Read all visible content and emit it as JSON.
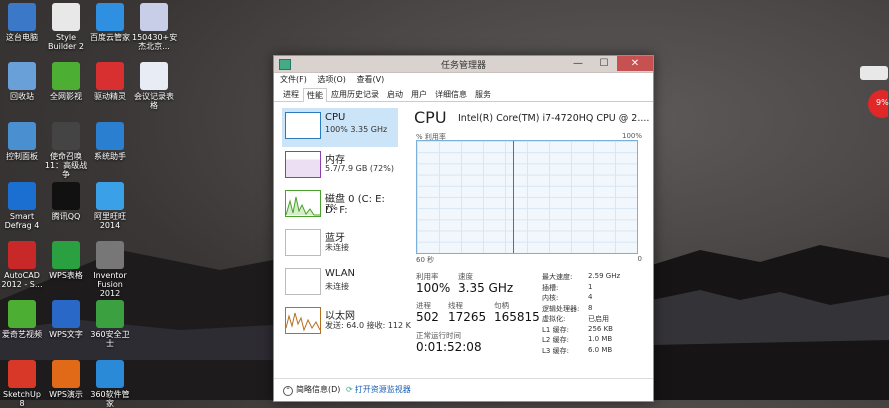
{
  "desktop": {
    "icons": [
      {
        "label": "这台电脑",
        "icon": "computer-icon",
        "color": "#3c78c8"
      },
      {
        "label": "Style Builder 2",
        "icon": "style-builder-icon",
        "color": "#e8e8e8"
      },
      {
        "label": "百度云管家",
        "icon": "baidu-cloud-icon",
        "color": "#2f8fe0"
      },
      {
        "label": "150430+安杰北京...",
        "icon": "file-icon",
        "color": "#c8cde8"
      },
      {
        "label": "回收站",
        "icon": "recycle-bin-icon",
        "color": "#6aa0d8"
      },
      {
        "label": "全网影视",
        "icon": "iqiyi-icon",
        "color": "#4cae32"
      },
      {
        "label": "驱动精灵",
        "icon": "driver-genius-icon",
        "color": "#d83030"
      },
      {
        "label": "会议记录表格",
        "icon": "doc-icon",
        "color": "#e8ecf4"
      },
      {
        "label": "控制面板",
        "icon": "control-panel-icon",
        "color": "#4a90d0"
      },
      {
        "label": "使命召唤11：高级战争",
        "icon": "game-icon",
        "color": "#444"
      },
      {
        "label": "系统助手",
        "icon": "system-assistant-icon",
        "color": "#2a7fd0"
      },
      {
        "label": "Smart Defrag 4",
        "icon": "defrag-icon",
        "color": "#1a6fd0"
      },
      {
        "label": "腾讯QQ",
        "icon": "qq-icon",
        "color": "#111"
      },
      {
        "label": "阿里旺旺 2014",
        "icon": "aliwangwang-icon",
        "color": "#3aa0e8"
      },
      {
        "label": "AutoCAD 2012 - S...",
        "icon": "autocad-icon",
        "color": "#c82828"
      },
      {
        "label": "WPS表格",
        "icon": "wps-sheet-icon",
        "color": "#2aa040"
      },
      {
        "label": "Inventor Fusion 2012",
        "icon": "inventor-icon",
        "color": "#777"
      },
      {
        "label": "爱奇艺视频",
        "icon": "iqiyi-video-icon",
        "color": "#4cae32"
      },
      {
        "label": "WPS文字",
        "icon": "wps-writer-icon",
        "color": "#2a68c8"
      },
      {
        "label": "360安全卫士",
        "icon": "360-security-icon",
        "color": "#3aa040"
      },
      {
        "label": "SketchUp 8",
        "icon": "sketchup-icon",
        "color": "#d83828"
      },
      {
        "label": "WPS演示",
        "icon": "wps-present-icon",
        "color": "#e06a18"
      },
      {
        "label": "360软件管家",
        "icon": "360-software-icon",
        "color": "#2a8ad8"
      }
    ]
  },
  "window": {
    "title": "任务管理器",
    "controls": {
      "minimize": "—",
      "maximize": "☐",
      "close": "✕"
    },
    "menu": [
      "文件(F)",
      "选项(O)",
      "查看(V)"
    ],
    "tabs": [
      "进程",
      "性能",
      "应用历史记录",
      "启动",
      "用户",
      "详细信息",
      "服务"
    ],
    "active_tab": "性能"
  },
  "sidebar": {
    "items": [
      {
        "name": "CPU",
        "sub": "100% 3.35 GHz",
        "color": "#2b7bbd"
      },
      {
        "name": "内存",
        "sub": "5.7/7.9 GB (72%)",
        "color": "#8b3fb0"
      },
      {
        "name": "磁盘 0 (C: E: D: F:",
        "sub": "7%",
        "color": "#4aa02c"
      },
      {
        "name": "蓝牙",
        "sub": "未连接",
        "color": "#999"
      },
      {
        "name": "WLAN",
        "sub": "未连接",
        "color": "#999"
      },
      {
        "name": "以太网",
        "sub": "发送: 64.0 接收: 112 K",
        "color": "#b56f1e"
      }
    ]
  },
  "main": {
    "title": "CPU",
    "model": "Intel(R) Core(TM) i7-4720HQ CPU @ 2....",
    "graph_label": "% 利用率",
    "graph_max": "100%",
    "graph_time": "60 秒",
    "graph_min": "0",
    "stats": {
      "util_label": "利用率",
      "util": "100%",
      "speed_label": "速度",
      "speed": "3.35 GHz",
      "proc_label": "进程",
      "proc": "502",
      "thread_label": "线程",
      "thread": "17265",
      "handle_label": "句柄",
      "handle": "165815",
      "uptime_label": "正常运行时间",
      "uptime": "0:01:52:08"
    },
    "specs": [
      {
        "k": "最大速度:",
        "v": "2.59 GHz"
      },
      {
        "k": "插槽:",
        "v": "1"
      },
      {
        "k": "内核:",
        "v": "4"
      },
      {
        "k": "逻辑处理器:",
        "v": "8"
      },
      {
        "k": "虚拟化:",
        "v": "已启用"
      },
      {
        "k": "L1 缓存:",
        "v": "256 KB"
      },
      {
        "k": "L2 缓存:",
        "v": "1.0 MB"
      },
      {
        "k": "L3 缓存:",
        "v": "6.0 MB"
      }
    ]
  },
  "footer": {
    "less": "简略信息(D)",
    "monitor": "打开资源监视器"
  },
  "badge": {
    "text": "9%"
  }
}
